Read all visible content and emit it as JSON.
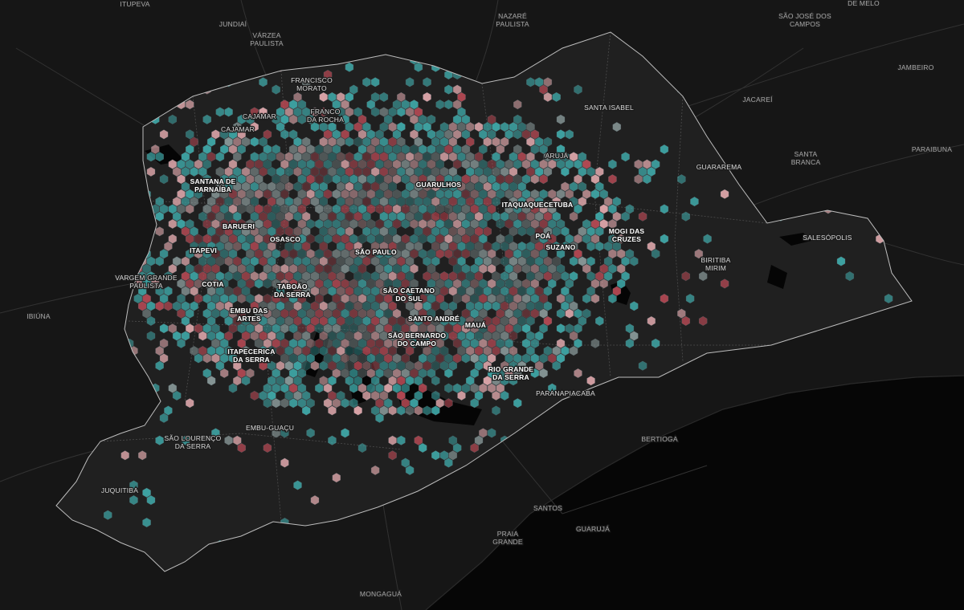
{
  "map": {
    "colors": {
      "background": "#161616",
      "ocean": "#060606",
      "land_region": "#222222",
      "border": "#bdbdbd",
      "road": "#333333",
      "reservoir": "#050505",
      "hex_teal": "#3fa9a9",
      "hex_red": "#b84a55",
      "hex_pink": "#e1a9ad",
      "hex_grey": "#8a9a9a",
      "hex_outline": "#5c6d72"
    },
    "labels": {
      "itupeva": "ITUPEVA",
      "jundiai": "JUNDIAÍ",
      "varzea_paulista": [
        "VÁRZEA",
        "PAULISTA"
      ],
      "nazare_paulista": [
        "NAZARÉ",
        "PAULISTA"
      ],
      "sao_jose_dos_campos": [
        "SÃO JOSÉ DOS",
        "CAMPOS"
      ],
      "de_melo": "DE MELO",
      "jambeiro": "JAMBEIRO",
      "francisco_morato": [
        "FRANCISCO",
        "MORATO"
      ],
      "franco_da_rocha": [
        "FRANCO",
        "DA ROCHA"
      ],
      "cajamar_upper": "CAJAMAR",
      "cajamar_lower": "CAJAMAR",
      "santa_isabel": "SANTA ISABEL",
      "jacarei": "JACAREÍ",
      "aruja": "ARUJÁ",
      "santa_branca": [
        "SANTA",
        "BRANCA"
      ],
      "paraibuna": "PARAIBUNA",
      "guararema": "GUARAREMA",
      "santana_de_parnaiba": [
        "SANTANA DE",
        "PARNAÍBA"
      ],
      "guarulhos": "GUARULHOS",
      "itaquaquecetuba": "ITAQUAQUECETUBA",
      "barueri": "BARUERI",
      "osasco": "OSASCO",
      "poa": "POÁ",
      "mogi_das_cruzes": [
        "MOGI DAS",
        "CRUZES"
      ],
      "salesopolis": "SALESÓPOLIS",
      "itapevi": "ITAPEVI",
      "sao_paulo": "SÃO PAULO",
      "suzano": "SUZANO",
      "biritiba_mirim": [
        "BIRITIBA",
        "MIRIM"
      ],
      "vargem_grande_paulista": [
        "VARGEM GRANDE",
        "PAULISTA"
      ],
      "cotia": "COTIA",
      "taboao_da_serra": [
        "TABOÃO",
        "DA SERRA"
      ],
      "sao_caetano_do_sul": [
        "SÃO CAETANO",
        "DO SUL"
      ],
      "ibiuna": "IBIÚNA",
      "embu_das_artes": [
        "EMBU DAS",
        "ARTES"
      ],
      "santo_andre": "SANTO ANDRÉ",
      "maua": "MAUÁ",
      "sao_bernardo_do_campo": [
        "SÃO BERNARDO",
        "DO CAMPO"
      ],
      "itapecerica_da_serra": [
        "ITAPECERICA",
        "DA SERRA"
      ],
      "rio_grande_da_serra": [
        "RIO GRANDE",
        "DA SERRA"
      ],
      "paranapiacaba": "PARANAPIACABA",
      "embu_guacu": "EMBU-GUAÇU",
      "sao_lourenco_da_serra": [
        "SÃO LOURENÇO",
        "DA SERRA"
      ],
      "bertioga": "BERTIOGA",
      "juquitiba": "JUQUITIBA",
      "santos": "SANTOS",
      "praia_grande": [
        "PRAIA",
        "GRANDE"
      ],
      "guaruja": "GUARUJÁ",
      "mongagua": "MONGAGUÁ"
    }
  }
}
